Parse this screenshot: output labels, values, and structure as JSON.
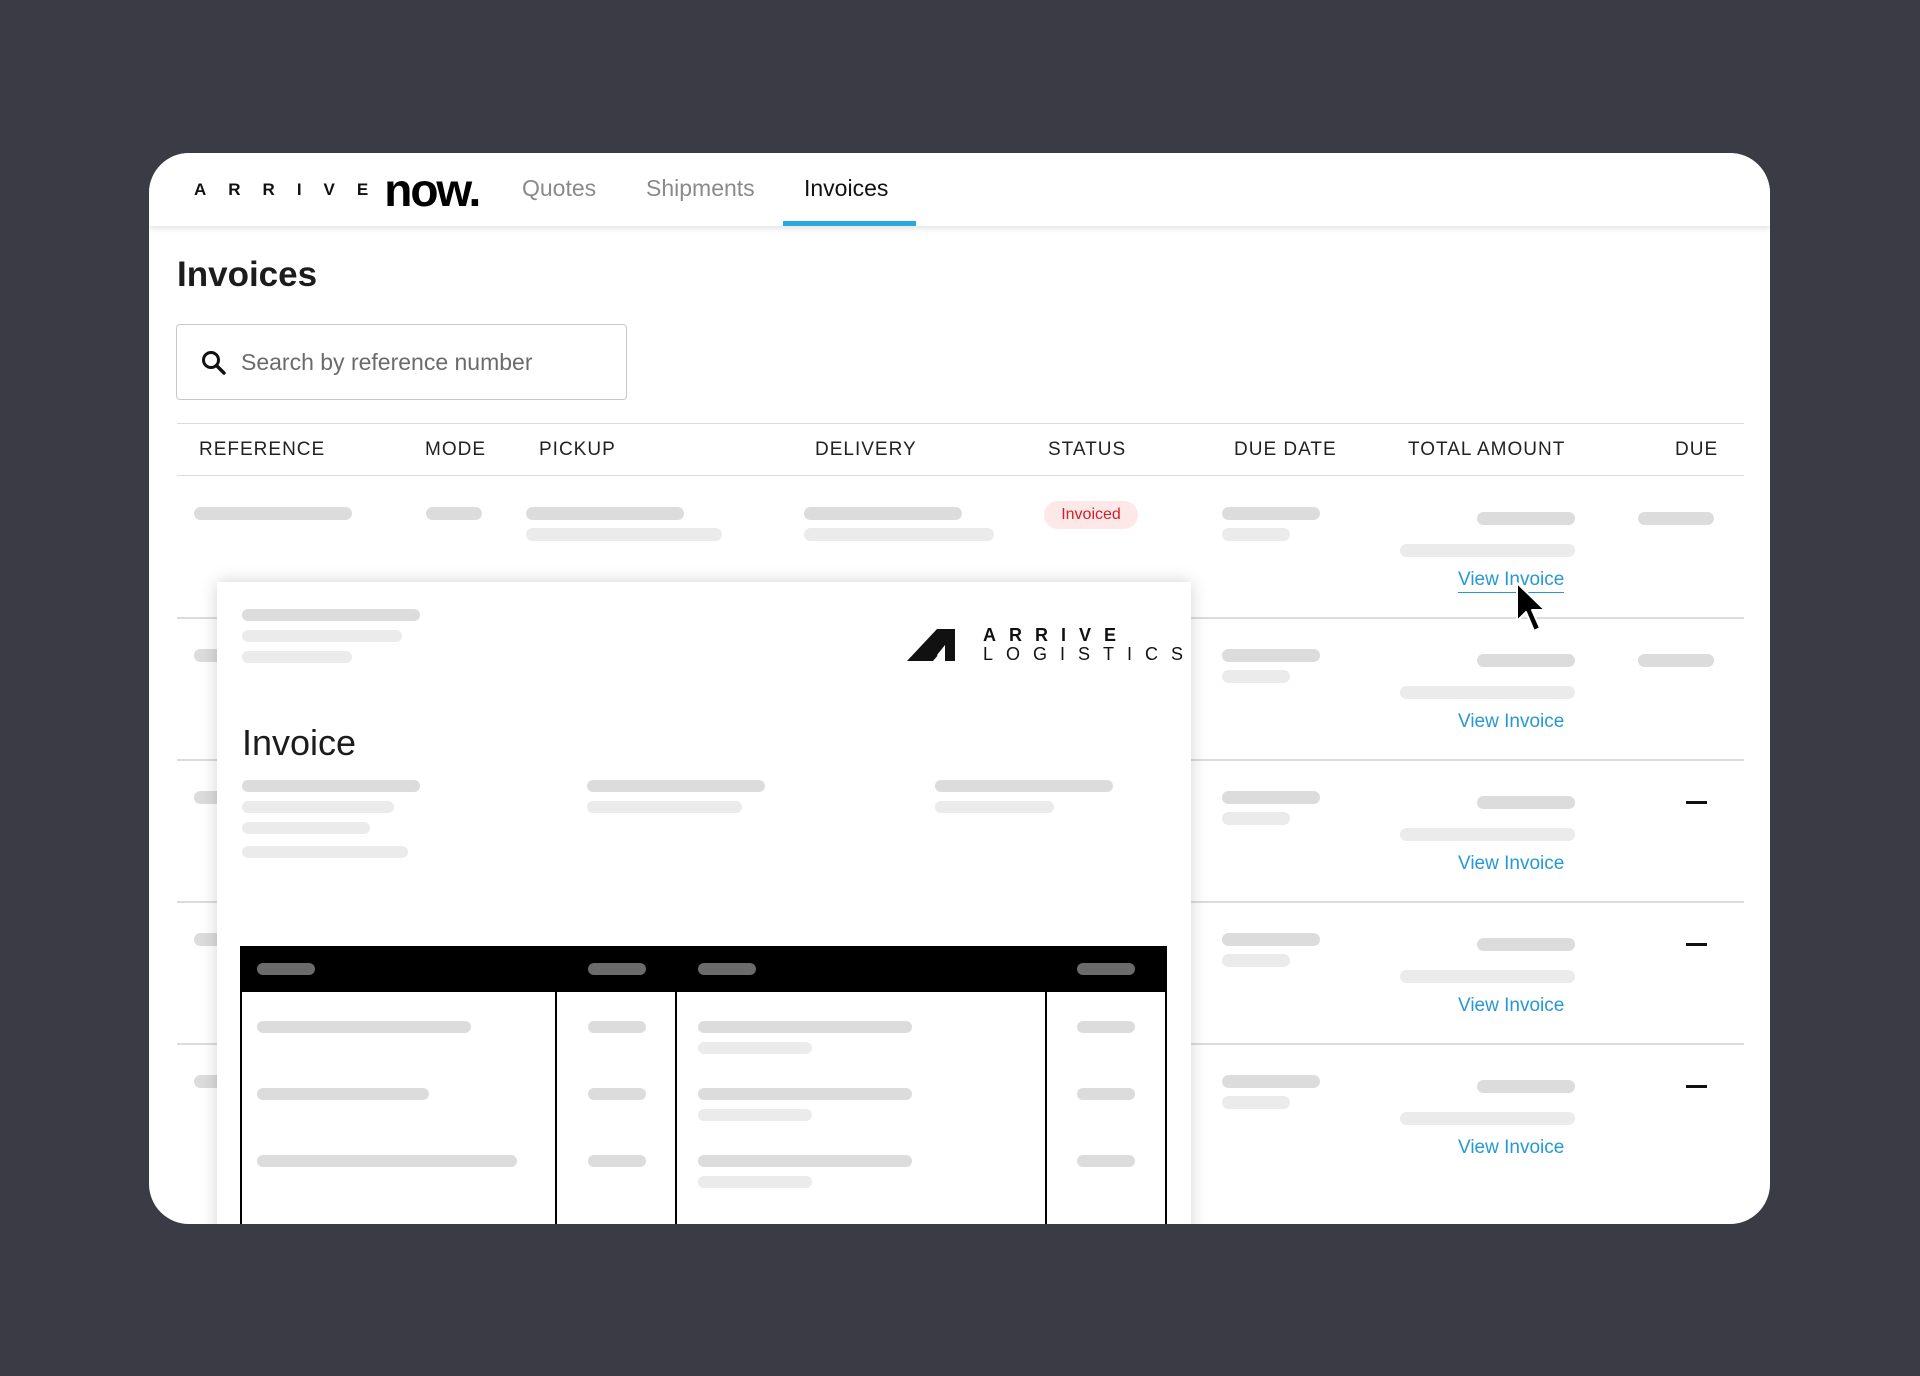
{
  "brand": {
    "word": "ARRIVE",
    "product": "now."
  },
  "nav": {
    "tabs": [
      {
        "label": "Quotes"
      },
      {
        "label": "Shipments"
      },
      {
        "label": "Invoices"
      }
    ],
    "active_tab": "Invoices"
  },
  "page": {
    "title": "Invoices"
  },
  "search": {
    "placeholder": "Search by reference number",
    "icon": "search-icon"
  },
  "table": {
    "columns": [
      "REFERENCE",
      "MODE",
      "PICKUP",
      "DELIVERY",
      "STATUS",
      "DUE DATE",
      "TOTAL AMOUNT",
      "DUE"
    ],
    "status_badge": "Invoiced",
    "rows": [
      {
        "action": "View Invoice"
      },
      {
        "action": "View Invoice"
      },
      {
        "action": "View Invoice",
        "due": "–"
      },
      {
        "action": "View Invoice",
        "due": "–"
      },
      {
        "action": "View Invoice",
        "due": "–"
      }
    ]
  },
  "invoice_preview": {
    "title": "Invoice",
    "logo": {
      "line1": "ARRIVE",
      "line2": "LOGISTICS"
    }
  },
  "colors": {
    "accent": "#29a9e0",
    "link": "#2599d4",
    "badge_text": "#d0202a",
    "badge_bg": "#fde8e8",
    "backdrop": "#3b3b45"
  }
}
